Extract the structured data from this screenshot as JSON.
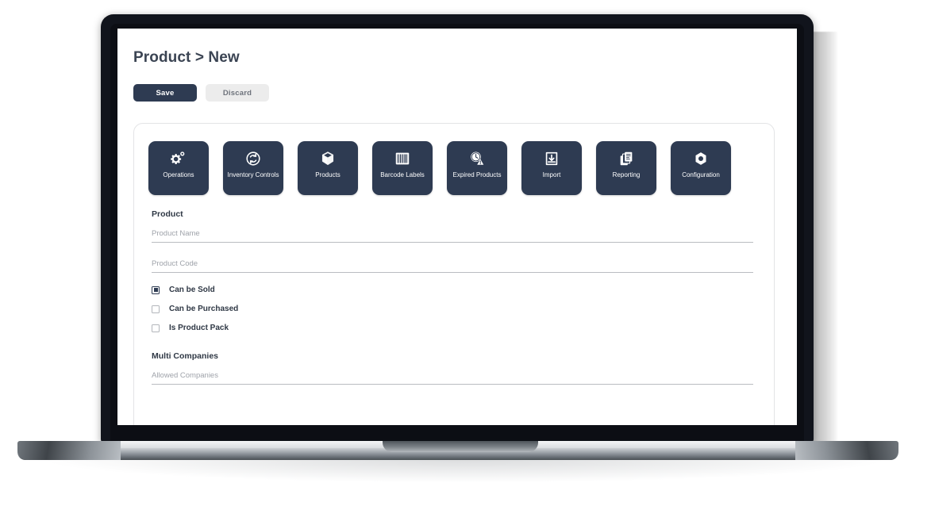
{
  "page": {
    "title": "Product > New"
  },
  "toolbar": {
    "save_label": "Save",
    "discard_label": "Discard"
  },
  "tiles": [
    {
      "label": "Operations",
      "icon": "gears-icon"
    },
    {
      "label": "Inventory Controls",
      "icon": "sync-circle-icon"
    },
    {
      "label": "Products",
      "icon": "cube-icon"
    },
    {
      "label": "Barcode Labels",
      "icon": "barcode-icon"
    },
    {
      "label": "Expired Products",
      "icon": "clock-warning-icon"
    },
    {
      "label": "Import",
      "icon": "download-tray-icon"
    },
    {
      "label": "Reporting",
      "icon": "documents-stack-icon"
    },
    {
      "label": "Configuration",
      "icon": "hex-nut-icon"
    }
  ],
  "form": {
    "product_heading": "Product",
    "product_name_placeholder": "Product Name",
    "product_name_value": "",
    "product_code_placeholder": "Product Code",
    "product_code_value": "",
    "checkboxes": [
      {
        "label": "Can be Sold",
        "checked": true
      },
      {
        "label": "Can be Purchased",
        "checked": false
      },
      {
        "label": "Is Product Pack",
        "checked": false
      }
    ],
    "multi_companies_heading": "Multi Companies",
    "allowed_companies_placeholder": "Allowed Companies",
    "allowed_companies_value": ""
  },
  "colors": {
    "accent_navy": "#2e3b52",
    "discard_gray": "#ececec",
    "text_dark": "#2f3845",
    "placeholder_gray": "#9fa3aa",
    "bezel": "#11141c"
  }
}
